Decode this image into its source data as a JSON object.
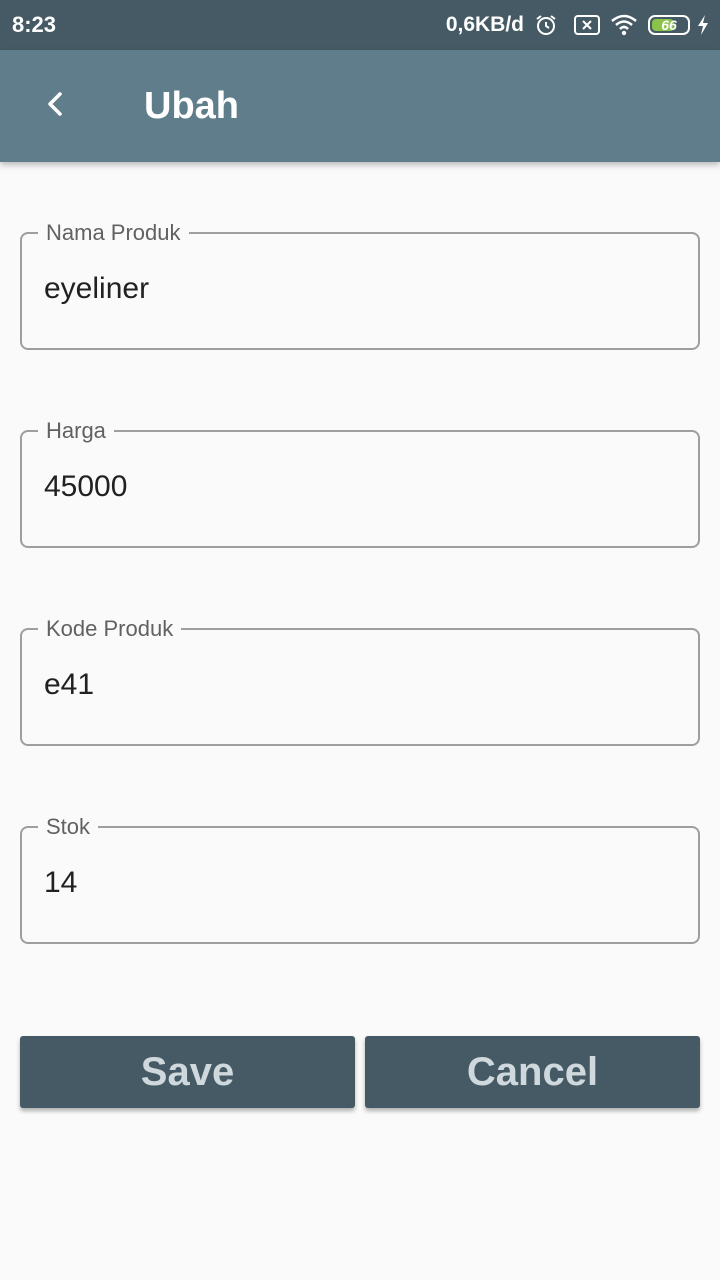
{
  "status_bar": {
    "time": "8:23",
    "network_speed": "0,6KB/d",
    "battery_level": "66",
    "battery_fraction": 0.66,
    "battery_color": "#8bc34a",
    "icons": [
      "alarm-icon",
      "sim-x-icon",
      "wifi-icon",
      "battery-icon",
      "charging-icon"
    ]
  },
  "app_bar": {
    "title": "Ubah",
    "back_icon": "chevron-left-icon",
    "color": "#607d8b"
  },
  "form": {
    "fields": [
      {
        "label": "Nama Produk",
        "value": "eyeliner"
      },
      {
        "label": "Harga",
        "value": "45000"
      },
      {
        "label": "Kode Produk",
        "value": "e41"
      },
      {
        "label": "Stok",
        "value": "14"
      }
    ]
  },
  "actions": {
    "save_label": "Save",
    "cancel_label": "Cancel",
    "button_color": "#455a64"
  }
}
